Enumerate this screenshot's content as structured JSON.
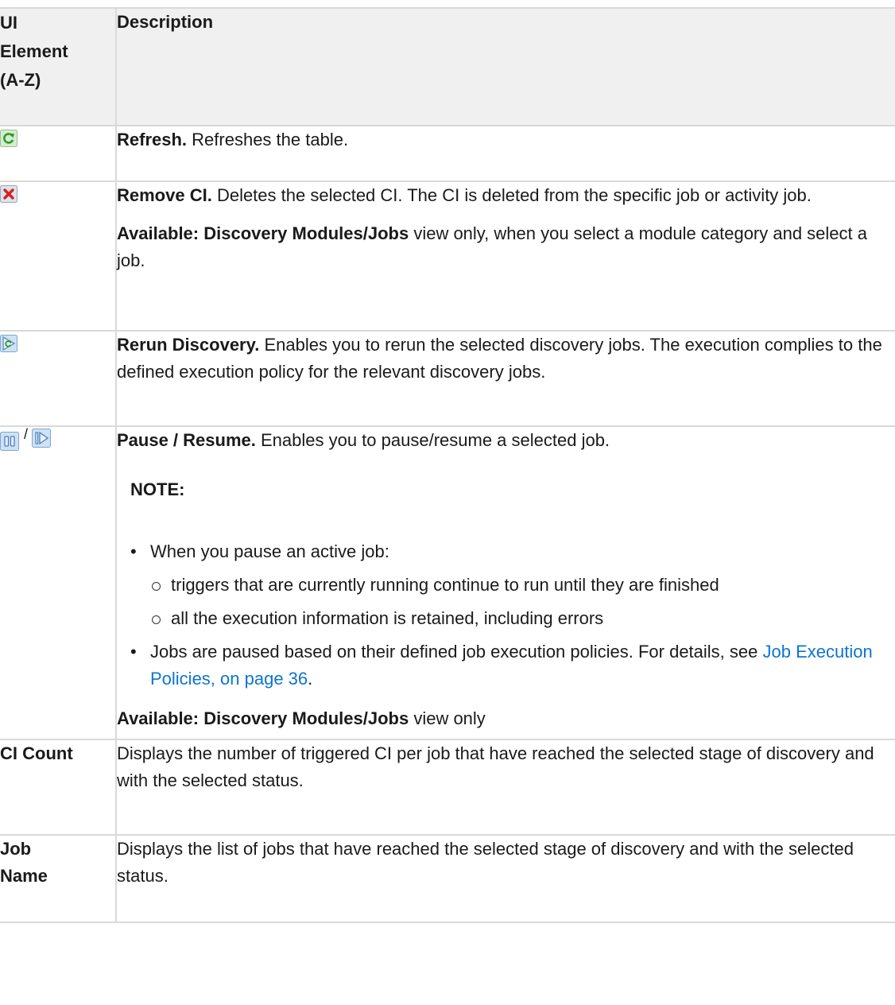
{
  "table": {
    "header": {
      "col1": [
        "UI",
        "Element",
        "(A-Z)"
      ],
      "col2": "Description"
    },
    "rows": {
      "refresh": {
        "icon": "refresh-icon",
        "term": "Refresh.",
        "desc": " Refreshes the table."
      },
      "remove": {
        "icon": "remove-ci-icon",
        "term": "Remove CI.",
        "desc": " Deletes the selected CI. The CI is deleted from the specific job or activity job.",
        "avail_label": "Available: Discovery Modules/Jobs",
        "avail_text": " view only, when you select a module category and select a job."
      },
      "rerun": {
        "icon": "rerun-discovery-icon",
        "term": "Rerun Discovery.",
        "desc": " Enables you to rerun the selected discovery jobs. The execution complies to the defined execution policy for the relevant discovery jobs."
      },
      "pause": {
        "icons": [
          "pause-icon",
          "resume-icon"
        ],
        "separator": "/",
        "term": "Pause / Resume.",
        "desc": " Enables you to pause/resume a selected job.",
        "note_label": "NOTE:",
        "bullet1": "When you pause an active job:",
        "sub1": "triggers that are currently running continue to run until they are finished",
        "sub2": "all the execution information is retained, including errors",
        "bullet2": "Jobs are paused based on their defined job execution policies. For details, see ",
        "link": "Job Execution Policies, on page 36",
        "bullet2_end": ".",
        "avail_label": "Available: Discovery Modules/Jobs",
        "avail_text": " view only"
      },
      "ci_count": {
        "term": "CI Count",
        "desc": "Displays the number of triggered CI per job that have reached the selected stage of discovery and with the selected status."
      },
      "job_name": {
        "term": [
          "Job",
          "Name"
        ],
        "desc": "Displays the list of jobs that have reached the selected stage of discovery and with the selected status."
      }
    }
  },
  "colors": {
    "link": "#0d74d1",
    "header_bg": "#f0f0f0",
    "border": "#d9d9d9"
  }
}
